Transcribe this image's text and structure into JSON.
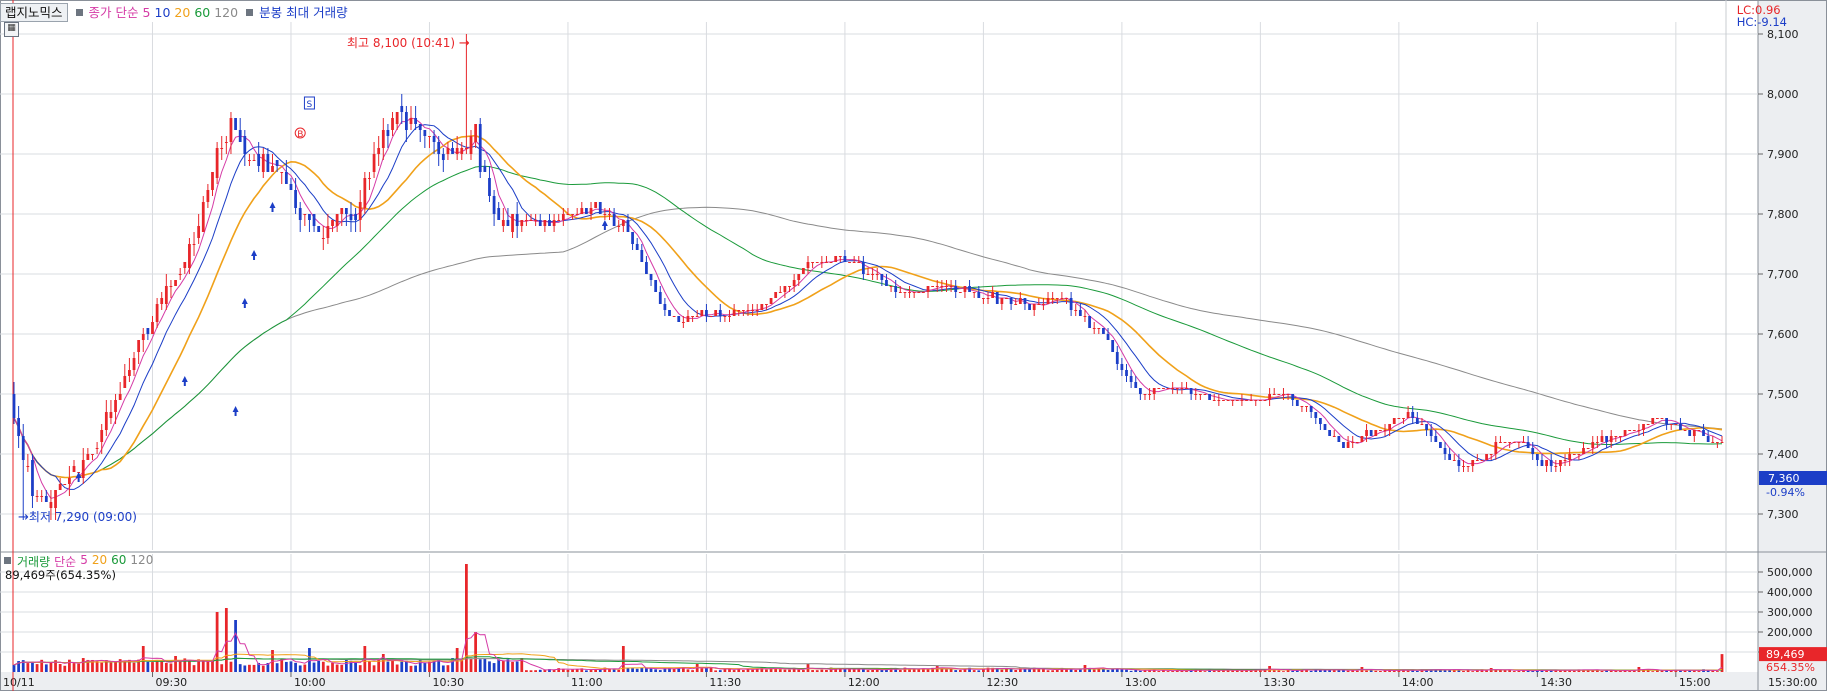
{
  "header": {
    "stock_name": "랩지노믹스",
    "price_type": "종가",
    "ma_type": "단순",
    "ma_periods": [
      "5",
      "10",
      "20",
      "60",
      "120"
    ],
    "chart_kind": "분봉",
    "max_label": "최대",
    "volume_label": "거래량"
  },
  "corner": {
    "lc": "LC:0.96",
    "hc": "HC:-9.14"
  },
  "annotations": {
    "high": "최고 8,100 (10:41)",
    "low": "최저 7,290 (09:00)"
  },
  "current": {
    "price": "7,360",
    "change": "-0.94%"
  },
  "volume_panel": {
    "label": "거래량",
    "ma_type": "단순",
    "ma_periods": [
      "5",
      "20",
      "60",
      "120"
    ],
    "info": "89,469주(654.35%)",
    "current_value": "89,469",
    "current_pct": "654.35%"
  },
  "x_axis": {
    "date": "10/11",
    "end_time": "15:30:00"
  },
  "colors": {
    "up": "#e8262a",
    "down": "#1c3ec7",
    "ma5": "#d53ba6",
    "ma10": "#1c3ec7",
    "ma20": "#f0a11a",
    "ma60": "#1a9a3a",
    "ma120": "#8a8a8a",
    "grid": "#d9dce0",
    "axis_bg": "#eceef1"
  },
  "chart_data": [
    {
      "type": "candlestick",
      "x_ticks": [
        "09:30",
        "10:00",
        "10:30",
        "11:00",
        "11:30",
        "12:00",
        "12:30",
        "13:00",
        "13:30",
        "14:00",
        "14:30",
        "15:00"
      ],
      "y_ticks": [
        "8,100",
        "8,000",
        "7,900",
        "7,800",
        "7,700",
        "7,600",
        "7,500",
        "7,400",
        "7,300"
      ],
      "ylim": [
        7240,
        8120
      ],
      "close_path": [
        [
          0,
          7460
        ],
        [
          5,
          7320
        ],
        [
          12,
          7360
        ],
        [
          18,
          7420
        ],
        [
          24,
          7520
        ],
        [
          28,
          7600
        ],
        [
          32,
          7660
        ],
        [
          36,
          7700
        ],
        [
          40,
          7780
        ],
        [
          44,
          7900
        ],
        [
          47,
          7950
        ],
        [
          50,
          7900
        ],
        [
          54,
          7890
        ],
        [
          58,
          7860
        ],
        [
          62,
          7800
        ],
        [
          66,
          7760
        ],
        [
          70,
          7790
        ],
        [
          74,
          7800
        ],
        [
          78,
          7900
        ],
        [
          82,
          7960
        ],
        [
          86,
          7950
        ],
        [
          90,
          7920
        ],
        [
          94,
          7900
        ],
        [
          98,
          7920
        ],
        [
          100,
          7950
        ],
        [
          101,
          7880
        ],
        [
          104,
          7800
        ],
        [
          108,
          7790
        ],
        [
          114,
          7780
        ],
        [
          120,
          7800
        ],
        [
          126,
          7810
        ],
        [
          132,
          7780
        ],
        [
          136,
          7720
        ],
        [
          140,
          7650
        ],
        [
          144,
          7620
        ],
        [
          148,
          7630
        ],
        [
          152,
          7640
        ],
        [
          156,
          7630
        ],
        [
          160,
          7640
        ],
        [
          164,
          7660
        ],
        [
          168,
          7680
        ],
        [
          172,
          7720
        ],
        [
          176,
          7720
        ],
        [
          180,
          7730
        ],
        [
          184,
          7710
        ],
        [
          190,
          7680
        ],
        [
          196,
          7670
        ],
        [
          202,
          7680
        ],
        [
          208,
          7670
        ],
        [
          214,
          7660
        ],
        [
          220,
          7650
        ],
        [
          226,
          7660
        ],
        [
          230,
          7640
        ],
        [
          236,
          7600
        ],
        [
          240,
          7540
        ],
        [
          244,
          7500
        ],
        [
          250,
          7510
        ],
        [
          256,
          7500
        ],
        [
          262,
          7490
        ],
        [
          268,
          7490
        ],
        [
          274,
          7500
        ],
        [
          280,
          7480
        ],
        [
          284,
          7440
        ],
        [
          288,
          7410
        ],
        [
          292,
          7430
        ],
        [
          298,
          7450
        ],
        [
          302,
          7470
        ],
        [
          306,
          7440
        ],
        [
          310,
          7400
        ],
        [
          314,
          7380
        ],
        [
          318,
          7390
        ],
        [
          322,
          7420
        ],
        [
          326,
          7420
        ],
        [
          330,
          7390
        ],
        [
          334,
          7380
        ],
        [
          338,
          7400
        ],
        [
          342,
          7420
        ],
        [
          346,
          7430
        ],
        [
          352,
          7440
        ],
        [
          356,
          7460
        ],
        [
          362,
          7440
        ],
        [
          366,
          7430
        ],
        [
          370,
          7420
        ]
      ],
      "series": [
        {
          "name": "5",
          "values": []
        },
        {
          "name": "10",
          "values": []
        },
        {
          "name": "20",
          "values": []
        },
        {
          "name": "60",
          "values": []
        },
        {
          "name": "120",
          "values": []
        }
      ]
    },
    {
      "type": "bar",
      "y_ticks": [
        "500,000",
        "400,000",
        "300,000",
        "200,000",
        "100,000"
      ],
      "ylim": [
        0,
        560000
      ],
      "spikes": [
        [
          0,
          35000
        ],
        [
          10,
          40000
        ],
        [
          20,
          60000
        ],
        [
          28,
          130000
        ],
        [
          35,
          80000
        ],
        [
          44,
          300000
        ],
        [
          46,
          320000
        ],
        [
          48,
          260000
        ],
        [
          56,
          110000
        ],
        [
          64,
          120000
        ],
        [
          76,
          130000
        ],
        [
          80,
          90000
        ],
        [
          96,
          120000
        ],
        [
          98,
          540000
        ],
        [
          100,
          200000
        ],
        [
          110,
          70000
        ],
        [
          132,
          130000
        ],
        [
          148,
          40000
        ],
        [
          172,
          40000
        ],
        [
          200,
          30000
        ],
        [
          232,
          35000
        ],
        [
          272,
          30000
        ],
        [
          292,
          25000
        ],
        [
          320,
          20000
        ],
        [
          352,
          25000
        ],
        [
          370,
          89469
        ]
      ]
    }
  ]
}
